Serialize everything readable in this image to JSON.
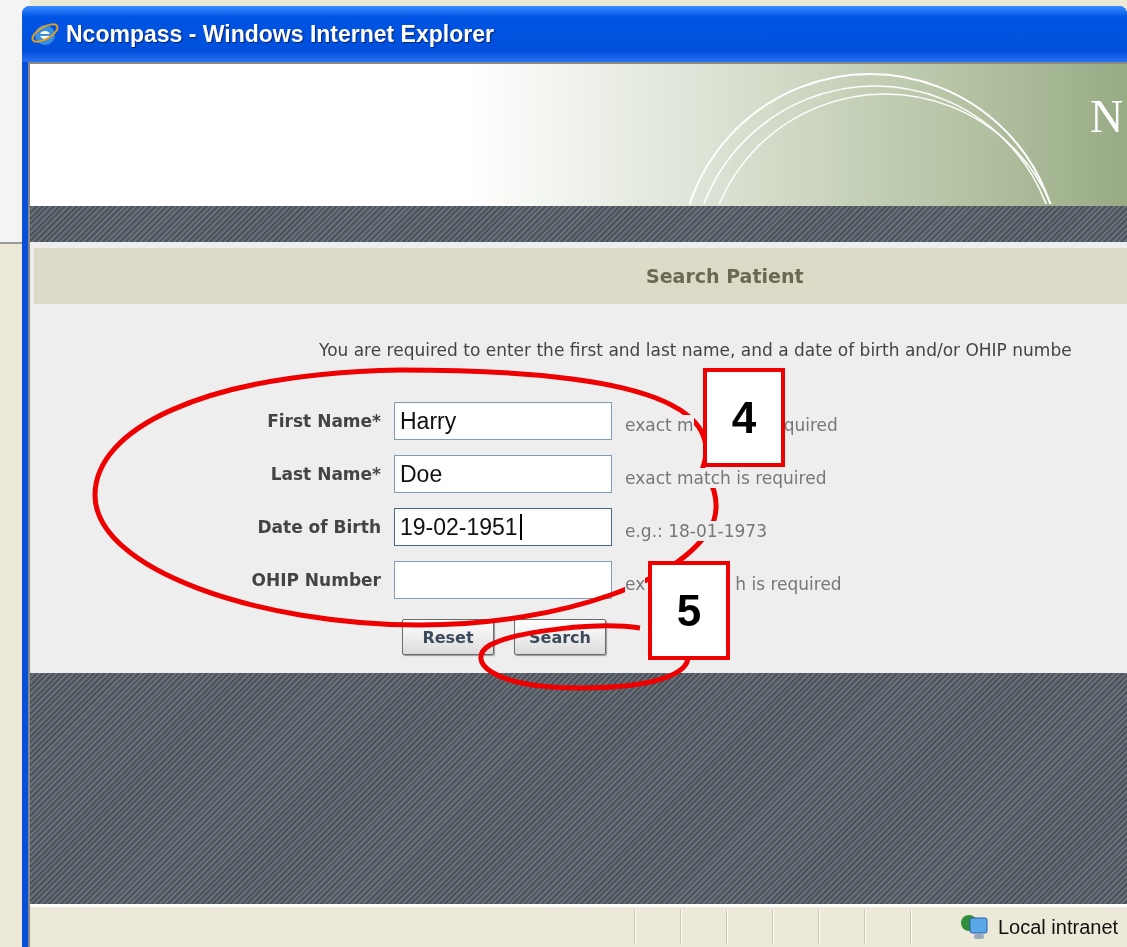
{
  "window": {
    "title": "Ncompass - Windows Internet Explorer"
  },
  "header": {
    "logo_text": "N"
  },
  "panel": {
    "title": "Search Patient",
    "instructions": "You are required to enter the first and last name, and a date of birth and/or OHIP numbe"
  },
  "fields": [
    {
      "label": "First Name*",
      "value": "Harry",
      "focused": false,
      "hint_parts": [
        "exact m",
        "quired"
      ]
    },
    {
      "label": "Last Name*",
      "value": "Doe",
      "focused": false,
      "hint_parts": [
        "exact match is required"
      ]
    },
    {
      "label": "Date of Birth",
      "value": "19-02-1951",
      "focused": true,
      "hint_parts": [
        "e.g.: 18-01-1973"
      ]
    },
    {
      "label": "OHIP Number",
      "focused": false,
      "hint_parts": [
        "ex",
        "h is required"
      ]
    }
  ],
  "buttons": [
    "Reset",
    "Search"
  ],
  "status_bar": {
    "zone": "Local intranet"
  },
  "annotations": [
    {
      "number": "4"
    },
    {
      "number": "5"
    }
  ]
}
